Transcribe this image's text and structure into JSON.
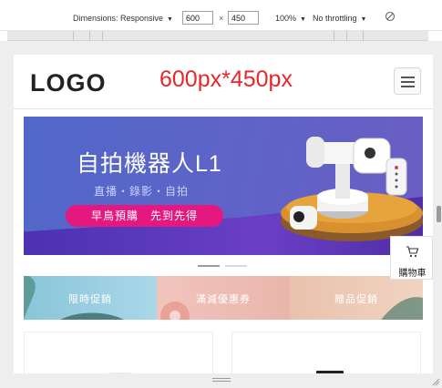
{
  "devtools": {
    "dimensions_label": "Dimensions: Responsive",
    "width_value": "600",
    "times_sign": "×",
    "height_value": "450",
    "zoom": "100%",
    "throttling": "No throttling"
  },
  "site": {
    "logo": "LOGO",
    "size_note": "600px*450px",
    "banner": {
      "title": "自拍機器人L1",
      "subtitle": "直播・錄影・自拍",
      "cta": "早鳥預購　先到先得"
    },
    "categories": [
      {
        "label": "限時促銷"
      },
      {
        "label": "滿減優惠券"
      },
      {
        "label": "贈品促銷"
      }
    ],
    "cart_label": "購物車"
  },
  "colors": {
    "size_note": "#e8262a",
    "cta_bg": "#e4187f",
    "banner_blue": "#5168c9"
  },
  "icons": [
    "dropdown-caret-icon",
    "rotate-icon",
    "hamburger-menu-icon",
    "cart-icon",
    "resize-grip-icon"
  ]
}
